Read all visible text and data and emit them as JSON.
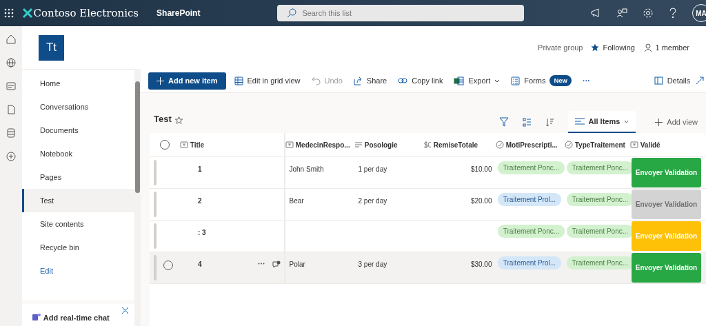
{
  "topbar": {
    "brand": "Contoso Electronics",
    "app": "SharePoint",
    "search": {
      "placeholder": "Search this list"
    },
    "avatar": "MA"
  },
  "site": {
    "logo": "Tt",
    "privacy": "Private group",
    "following": "Following",
    "members": "1 member"
  },
  "nav": [
    {
      "label": "Home",
      "selected": false,
      "kind": "item"
    },
    {
      "label": "Conversations",
      "selected": false,
      "kind": "item"
    },
    {
      "label": "Documents",
      "selected": false,
      "kind": "item"
    },
    {
      "label": "Notebook",
      "selected": false,
      "kind": "item"
    },
    {
      "label": "Pages",
      "selected": false,
      "kind": "item"
    },
    {
      "label": "Test",
      "selected": true,
      "kind": "item"
    },
    {
      "label": "Site contents",
      "selected": false,
      "kind": "item"
    },
    {
      "label": "Recycle bin",
      "selected": false,
      "kind": "item"
    },
    {
      "label": "Edit",
      "selected": false,
      "kind": "link"
    }
  ],
  "chat_panel": {
    "title": "Add real-time chat"
  },
  "commands": [
    {
      "kind": "primary",
      "label": "Add new item",
      "disabled": false
    },
    {
      "kind": "grid",
      "label": "Edit in grid view",
      "disabled": false
    },
    {
      "kind": "undo",
      "label": "Undo",
      "disabled": true
    },
    {
      "kind": "share",
      "label": "Share",
      "disabled": false
    },
    {
      "kind": "link",
      "label": "Copy link",
      "disabled": false
    },
    {
      "kind": "export",
      "label": "Export",
      "disabled": false
    },
    {
      "kind": "forms",
      "label": "Forms",
      "badge": "New",
      "disabled": false
    },
    {
      "kind": "more",
      "label": "···",
      "disabled": false
    }
  ],
  "details": "Details",
  "list": {
    "title": "Test",
    "view": "All Items",
    "add_view": "Add view"
  },
  "table": {
    "all_selected": false,
    "columns": [
      {
        "label": "Title",
        "kind": "text"
      },
      {
        "label": "MedecinRespo...",
        "kind": "text"
      },
      {
        "label": "Posologie",
        "kind": "lines"
      },
      {
        "label": "RemiseTotale",
        "kind": "currency"
      },
      {
        "label": "MotiPrescripti...",
        "kind": "choice"
      },
      {
        "label": "TypeTraitement",
        "kind": "choice"
      },
      {
        "label": "Validé",
        "kind": "text"
      }
    ],
    "rows": [
      {
        "hovered": false,
        "title": "1",
        "medecin": "John Smith",
        "posologie": "1 per day",
        "remise": "$10.00",
        "motif": {
          "label": "Traitement Ponc...",
          "color": "#d3f1cf"
        },
        "type": {
          "label": "Traitement Ponc...",
          "color": "#d3f1cf"
        },
        "action": {
          "label": "Envoyer Validation",
          "color": "#28a745"
        }
      },
      {
        "hovered": false,
        "title": "2",
        "medecin": "Bear",
        "posologie": "2 per day",
        "remise": "$20.00",
        "motif": {
          "label": "Traitement Prol...",
          "color": "#d4e7f8"
        },
        "type": {
          "label": "Traitement Ponc...",
          "color": "#d3f1cf"
        },
        "action": {
          "label": "Envoyer Validation",
          "color": "#d3d3d3"
        }
      },
      {
        "hovered": false,
        "title": ": 3",
        "medecin": "",
        "posologie": "",
        "remise": "",
        "motif": {
          "label": "Traitement Ponc...",
          "color": "#d3f1cf"
        },
        "type": {
          "label": "Traitement Ponc...",
          "color": "#d3f1cf"
        },
        "action": {
          "label": "Envoyer Validation",
          "color": "#ffc107"
        }
      },
      {
        "hovered": true,
        "title": "4",
        "medecin": "Polar",
        "posologie": "3 per day",
        "remise": "$30.00",
        "motif": {
          "label": "Traitement Prol...",
          "color": "#d4e7f8"
        },
        "type": {
          "label": "Traitement Ponc...",
          "color": "#d3f1cf"
        },
        "action": {
          "label": "Envoyer Validation",
          "color": "#28a745"
        }
      }
    ]
  }
}
